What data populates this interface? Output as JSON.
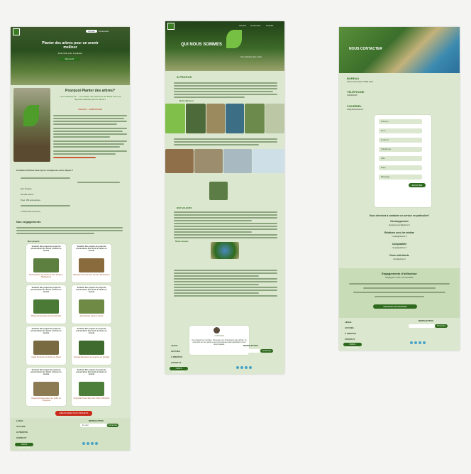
{
  "page1": {
    "hero_title": "Planter des arbres pour un avenir meilleur",
    "hero_sub": "Ensemble pour la planète",
    "nav": [
      "Accueil",
      "Connexion"
    ],
    "hero_button": "Découvrir",
    "section_title": "Pourquoi Planter des arbres?",
    "quote": "« Les solutions de ... Les arbres, les rivières et les forêts sont une réponse naturelle pour le climat »",
    "quote_label": "UNESCO - AMBASSADE",
    "question": "Combien d'arbres faut-il pour compenser notre impact ?",
    "stats_title": "Nos engagements",
    "stats": [
      "Nos Projets",
      "25 000 arbres",
      "Pour 150 entreprises",
      "1 000 tonnes de CO₂"
    ],
    "projects_label": "Nos projets",
    "projects": [
      {
        "title": "Soutenir Des projets de projet de préservation des forêts à travers le monde",
        "caption": "Reforestation des forêts de Pins Rouge à Madagascar"
      },
      {
        "title": "Soutenir Des projets de projet de préservation des forêts à travers le monde",
        "caption": "Reboisement Forêt des Sentiers Equatoriaux"
      },
      {
        "title": "Soutenir Des projets de projet de préservation des forêts à travers le monde",
        "caption": "Afrique Reconstituer la forêt Africaine"
      },
      {
        "title": "Soutenir Des projets de projet de préservation des forêts à travers le monde",
        "caption": "Mozambique Savane boisée"
      },
      {
        "title": "Soutenir Des projets de projet de préservation des forêts à travers le monde",
        "caption": "Népal Protection de forêts au Népal"
      },
      {
        "title": "Soutenir Des projets de projet de préservation des forêts à travers le monde",
        "caption": "Sénégal Restaurer la mangrove au Sénégal"
      },
      {
        "title": "Soutenir Des projets de projet de préservation des forêts à travers le monde",
        "caption": "Ouganda Préservation des forêts de l'Ouganda"
      },
      {
        "title": "Soutenir Des projets de projet de préservation des forêts à travers le monde",
        "caption": "Ouganda Préservation des forêts d'Albertine"
      }
    ],
    "cta_button": "DÉCOUVREZ NOS PROJETS",
    "footer_links": [
      "LEGAL",
      "ACCUEIL",
      "À PROPOS",
      "CONTACT"
    ],
    "newsletter_title": "NEWSLETTER",
    "newsletter_placeholder": "E-mail",
    "newsletter_button": "S'inscrire",
    "footer_button": "NOUS REJOINDRE"
  },
  "page2": {
    "hero_title": "QUI NOUS SOMMES",
    "hero_sub": "Une planète plus verte",
    "nav": [
      "Accueil",
      "Connexion",
      "Contact"
    ],
    "about_label": "À PROPOS",
    "gallery_label": "Notre Mission",
    "mission_label": "NOS VALEURS",
    "values_label": "Notre impact",
    "testimonial_name": "CAROLINE",
    "testimonial_text": "Ce programme m'enlève. Sœ aussi, sur l'importance des arbres. Je vous étes un bon partie et je recommande aussi significant il pour notre planète.",
    "footer_links": [
      "LEGAL",
      "ACCUEIL",
      "À PROPOS",
      "CONTACT"
    ],
    "newsletter_title": "NEWSLETTER",
    "newsletter_button": "S'inscrire",
    "footer_button": "NOUS REJOINDRE"
  },
  "page3": {
    "hero_title": "NOUS CONTACTER",
    "contact": [
      {
        "label": "BUREAU",
        "value": "123 rue des Forêts, 75001 Paris"
      },
      {
        "label": "TÉLÉPHONE",
        "value": "0102030405"
      },
      {
        "label": "COURRIEL",
        "value": "info@arbresavenir.fr"
      }
    ],
    "form_fields": [
      "Prénom",
      "Nom",
      "Courriel",
      "Téléphone",
      "Ville",
      "Pays",
      "Message"
    ],
    "form_button": "ENVOYER",
    "interest_title": "Vous cherchez à contacter un service en particulier?",
    "services": [
      {
        "label": "Développement",
        "value": "developpement@arbres.fr"
      },
      {
        "label": "Relations avec les médias",
        "value": "medias@arbres.fr"
      },
      {
        "label": "Comptabilité",
        "value": "compta@arbres.fr"
      },
      {
        "label": "Dons individuels",
        "value": "dons@arbres.fr"
      }
    ],
    "engagement_title": "Engagements d'utilisateur",
    "engagement_sub": "Rejoignez notre communauté",
    "engagement_button": "DEVENIR PARTENAIRE",
    "footer_links": [
      "LEGAL",
      "ACCUEIL",
      "À PROPOS",
      "CONTACT"
    ],
    "newsletter_title": "NEWSLETTER",
    "newsletter_button": "S'inscrire",
    "footer_button": "NOUS REJOINDRE"
  }
}
